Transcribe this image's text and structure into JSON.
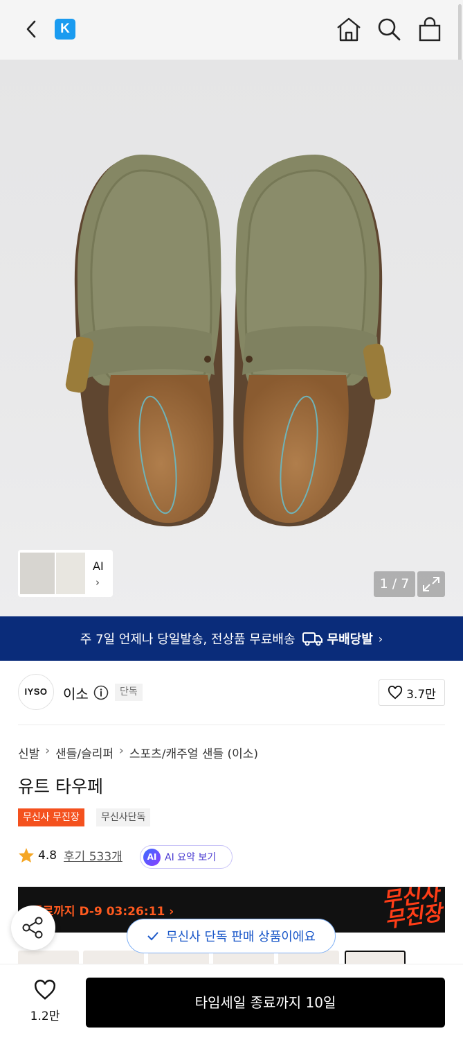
{
  "header": {
    "brand_badge": "K",
    "icons": [
      "back-icon",
      "home-icon",
      "search-icon",
      "shopping-bag-icon"
    ]
  },
  "gallery": {
    "thumbnail_label": "AI",
    "counter": "1 / 7"
  },
  "shipping_banner": {
    "text": "주 7일 언제나 당일발송, 전상품 무료배송",
    "service": "무배당발"
  },
  "brand": {
    "logo_text": "IYSO",
    "name": "이소",
    "badge": "단독",
    "likes": "3.7만"
  },
  "breadcrumb": [
    "신발",
    "샌들/슬리퍼",
    "스포츠/캐주얼 샌들 (이소)"
  ],
  "product": {
    "title": "유트 타우페",
    "tags": [
      "무신사 무진장",
      "무신사단독"
    ],
    "rating": "4.8",
    "reviews": "후기 533개",
    "ai_summary": "AI 요약 보기",
    "ai_badge": "AI"
  },
  "timesale": {
    "timer": "종료까지 D-9 03:26:11",
    "logo_line1": "무신사",
    "logo_line2": "무진장"
  },
  "toast": "무신사 단독 판매 상품이에요",
  "bottom": {
    "wish_count": "1.2만",
    "buy_label": "타임세일 종료까지 10일"
  },
  "colors": {
    "banner_bg": "#0a2c7a",
    "sale_tag": "#f4511e",
    "timer_text": "#ff5a1f",
    "accent_blue": "#1b58c9"
  }
}
